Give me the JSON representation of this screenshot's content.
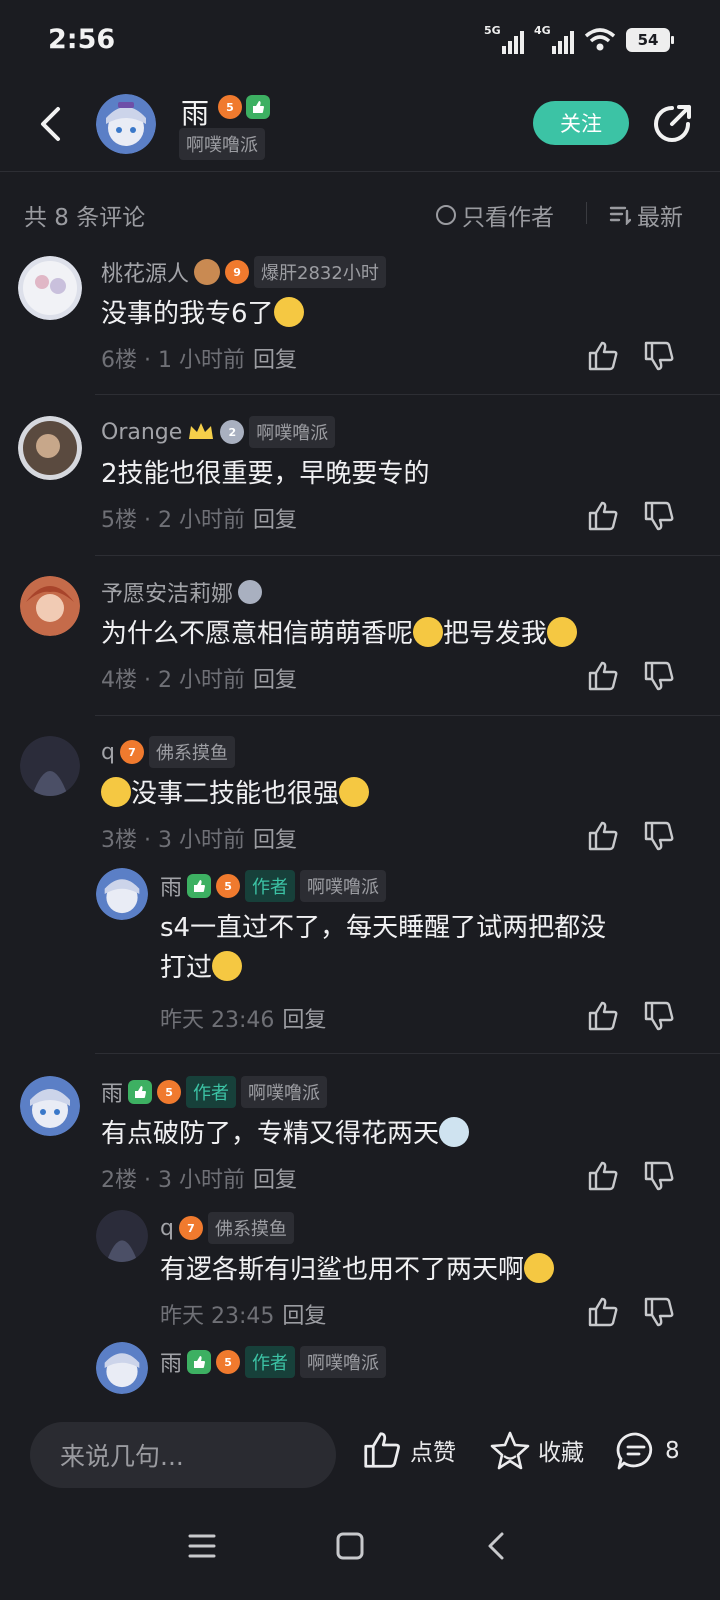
{
  "status_bar": {
    "time": "2:56",
    "signal1": "5G",
    "signal2": "4G",
    "battery": "54"
  },
  "header": {
    "username": "雨",
    "level_badge": "5",
    "tag": "啊噗噜派",
    "follow_label": "关注"
  },
  "filter": {
    "count_text": "共 8 条评论",
    "only_author": "只看作者",
    "sort": "最新"
  },
  "comments": [
    {
      "name": "桃花源人",
      "level": "9",
      "tag": "爆肝2832小时",
      "text": "没事的我专6了",
      "floor": "6楼 · 1 小时前",
      "reply": "回复"
    },
    {
      "name": "Orange",
      "level": "2",
      "tag": "啊噗噜派",
      "text": "2技能也很重要，早晚要专的",
      "floor": "5楼 · 2 小时前",
      "reply": "回复"
    },
    {
      "name": "予愿安洁莉娜",
      "text_a": "为什么不愿意相信萌萌香呢",
      "text_b": "把号发我",
      "floor": "4楼 · 2 小时前",
      "reply": "回复"
    },
    {
      "name": "q",
      "level": "7",
      "tag": "佛系摸鱼",
      "text": "没事二技能也很强",
      "floor": "3楼 · 3 小时前",
      "reply": "回复",
      "sub": {
        "name": "雨",
        "level": "5",
        "author": "作者",
        "tag": "啊噗噜派",
        "text_line1": "s4一直过不了，每天睡醒了试两把都没",
        "text_line2": "打过",
        "time": "昨天 23:46",
        "reply": "回复"
      }
    },
    {
      "name": "雨",
      "level": "5",
      "author": "作者",
      "tag": "啊噗噜派",
      "text": "有点破防了，专精又得花两天",
      "floor": "2楼 · 3 小时前",
      "reply": "回复",
      "sub": {
        "name": "q",
        "level": "7",
        "tag": "佛系摸鱼",
        "text": "有逻各斯有归鲨也用不了两天啊",
        "time": "昨天 23:45",
        "reply": "回复"
      },
      "sub2": {
        "name": "雨",
        "level": "5",
        "author": "作者",
        "tag": "啊噗噜派"
      }
    }
  ],
  "bottom": {
    "input_placeholder": "来说几句...",
    "like": "点赞",
    "favorite": "收藏",
    "comment_count": "8"
  },
  "colors": {
    "accent": "#3cc3a5",
    "background": "#1b1c21",
    "level_badge": "#f07a2e"
  }
}
